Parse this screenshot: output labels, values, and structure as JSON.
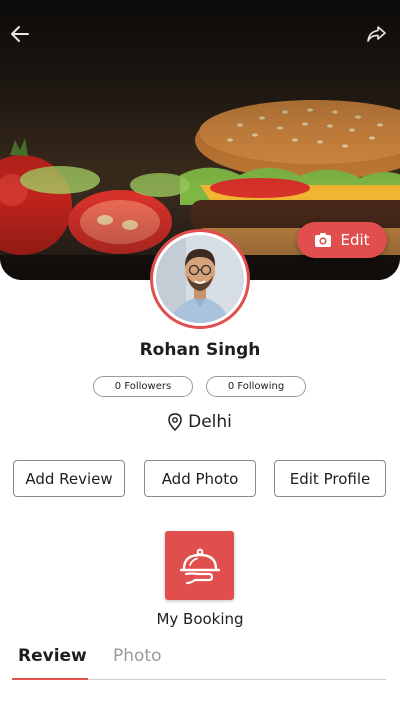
{
  "header": {
    "back_icon": "arrow-left-icon",
    "share_icon": "share-arrow-icon",
    "edit_cover_label": "Edit",
    "edit_cover_icon": "camera-icon"
  },
  "profile": {
    "name": "Rohan Singh",
    "followers_label": "0 Followers",
    "following_label": "0 Following",
    "location": "Delhi",
    "location_icon": "map-pin-icon"
  },
  "actions": {
    "add_review": "Add Review",
    "add_photo": "Add Photo",
    "edit_profile": "Edit Profile"
  },
  "booking": {
    "label": "My Booking",
    "icon": "food-cloche-icon"
  },
  "tabs": [
    {
      "label": "Review",
      "active": true
    },
    {
      "label": "Photo",
      "active": false
    }
  ],
  "colors": {
    "accent": "#e04e4e",
    "text": "#1e1e1e",
    "inactive_tab": "#9a9a9a"
  }
}
